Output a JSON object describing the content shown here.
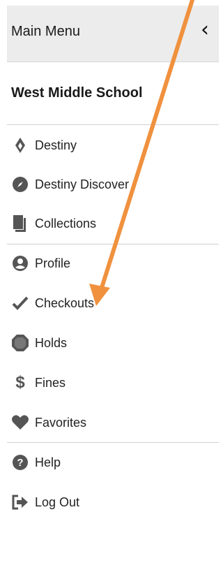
{
  "header": {
    "title": "Main Menu",
    "back_icon": "chevron-left-icon"
  },
  "school_name": "West Middle School",
  "menu": [
    {
      "label": "Destiny",
      "icon": "destiny-flame-icon"
    },
    {
      "label": "Destiny Discover",
      "icon": "compass-icon"
    },
    {
      "label": "Collections",
      "icon": "collections-icon"
    },
    {
      "label": "Profile",
      "icon": "user-circle-icon"
    },
    {
      "label": "Checkouts",
      "icon": "checkmark-icon"
    },
    {
      "label": "Holds",
      "icon": "octagon-icon"
    },
    {
      "label": "Fines",
      "icon": "dollar-icon"
    },
    {
      "label": "Favorites",
      "icon": "heart-icon"
    },
    {
      "label": "Help",
      "icon": "help-icon"
    },
    {
      "label": "Log Out",
      "icon": "logout-icon"
    }
  ],
  "annotation": {
    "color": "#f0913e"
  }
}
